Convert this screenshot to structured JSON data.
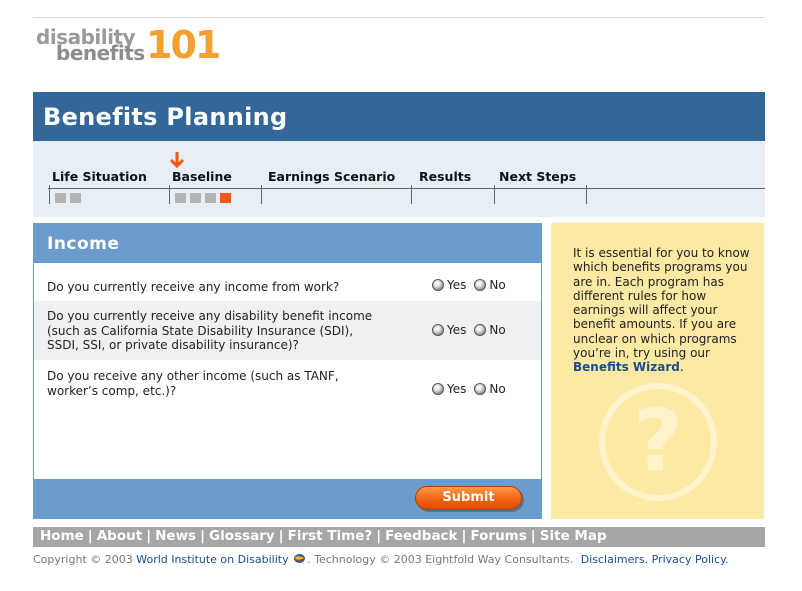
{
  "logo": {
    "word1": "disability",
    "word2": "benefits",
    "number": "101"
  },
  "title": "Benefits Planning",
  "steps": [
    {
      "label": "Life Situation",
      "squares": 2
    },
    {
      "label": "Baseline",
      "squares": 4,
      "current": true
    },
    {
      "label": "Earnings Scenario",
      "squares": 0
    },
    {
      "label": "Results",
      "squares": 0
    },
    {
      "label": "Next Steps",
      "squares": 0
    }
  ],
  "section": {
    "title": "Income",
    "questions": [
      {
        "text": "Do you currently receive any income from work?"
      },
      {
        "text_lines": [
          "Do you currently receive any disability benefit income",
          "(such as California State Disability Insurance (SDI),",
          "SSDI, SSI, or private disability insurance)?"
        ]
      },
      {
        "text_lines": [
          "Do you receive any other income (such as TANF,",
          "worker’s comp, etc.)?"
        ]
      }
    ],
    "option_yes": "Yes",
    "option_no": "No",
    "submit_label": "Submit"
  },
  "sidebar": {
    "text_before": "It is essential for you to know which benefits programs you are in. Each program has different rules for how earnings will affect your benefit amounts. If you are unclear on which programs you’re in, try using our ",
    "link": "Benefits Wizard",
    "text_after": ".",
    "watermark": "?"
  },
  "nav": {
    "items": [
      "Home",
      "About",
      "News",
      "Glossary",
      "First Time?",
      "Feedback",
      "Forums",
      "Site Map"
    ]
  },
  "footer": {
    "copyright": "Copyright © 2003 ",
    "org": "World Institute on Disability",
    "technology": ". Technology © 2003 Eightfold Way Consultants.",
    "disclaimers": "Disclaimers.",
    "privacy": "Privacy Policy."
  },
  "colors": {
    "header_blue": "#336699",
    "panel_blue": "#6c9ccc",
    "accent_orange": "#f05a14",
    "sidebar_yellow": "#fce9a4"
  }
}
